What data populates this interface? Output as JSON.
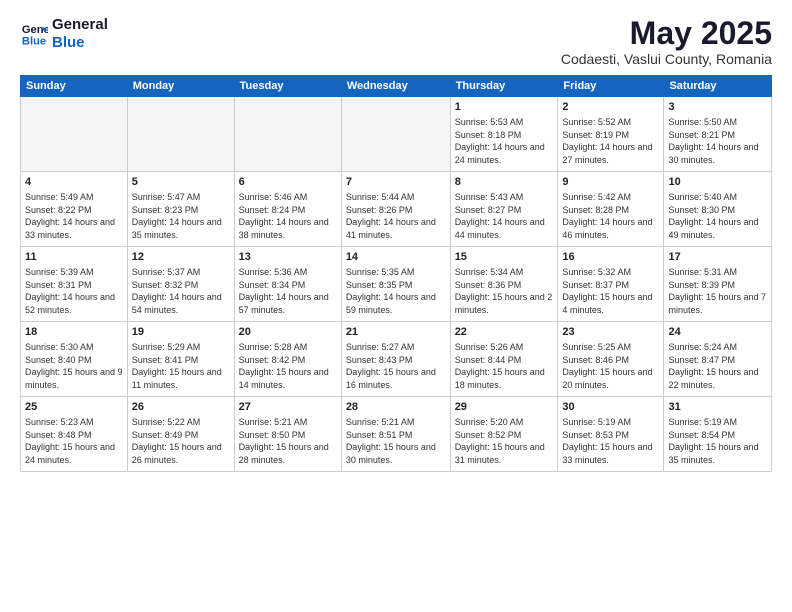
{
  "header": {
    "logo_line1": "General",
    "logo_line2": "Blue",
    "title": "May 2025",
    "subtitle": "Codaesti, Vaslui County, Romania"
  },
  "days": [
    "Sunday",
    "Monday",
    "Tuesday",
    "Wednesday",
    "Thursday",
    "Friday",
    "Saturday"
  ],
  "weeks": [
    [
      {
        "date": "",
        "info": ""
      },
      {
        "date": "",
        "info": ""
      },
      {
        "date": "",
        "info": ""
      },
      {
        "date": "",
        "info": ""
      },
      {
        "date": "1",
        "info": "Sunrise: 5:53 AM\nSunset: 8:18 PM\nDaylight: 14 hours and 24 minutes."
      },
      {
        "date": "2",
        "info": "Sunrise: 5:52 AM\nSunset: 8:19 PM\nDaylight: 14 hours and 27 minutes."
      },
      {
        "date": "3",
        "info": "Sunrise: 5:50 AM\nSunset: 8:21 PM\nDaylight: 14 hours and 30 minutes."
      }
    ],
    [
      {
        "date": "4",
        "info": "Sunrise: 5:49 AM\nSunset: 8:22 PM\nDaylight: 14 hours and 33 minutes."
      },
      {
        "date": "5",
        "info": "Sunrise: 5:47 AM\nSunset: 8:23 PM\nDaylight: 14 hours and 35 minutes."
      },
      {
        "date": "6",
        "info": "Sunrise: 5:46 AM\nSunset: 8:24 PM\nDaylight: 14 hours and 38 minutes."
      },
      {
        "date": "7",
        "info": "Sunrise: 5:44 AM\nSunset: 8:26 PM\nDaylight: 14 hours and 41 minutes."
      },
      {
        "date": "8",
        "info": "Sunrise: 5:43 AM\nSunset: 8:27 PM\nDaylight: 14 hours and 44 minutes."
      },
      {
        "date": "9",
        "info": "Sunrise: 5:42 AM\nSunset: 8:28 PM\nDaylight: 14 hours and 46 minutes."
      },
      {
        "date": "10",
        "info": "Sunrise: 5:40 AM\nSunset: 8:30 PM\nDaylight: 14 hours and 49 minutes."
      }
    ],
    [
      {
        "date": "11",
        "info": "Sunrise: 5:39 AM\nSunset: 8:31 PM\nDaylight: 14 hours and 52 minutes."
      },
      {
        "date": "12",
        "info": "Sunrise: 5:37 AM\nSunset: 8:32 PM\nDaylight: 14 hours and 54 minutes."
      },
      {
        "date": "13",
        "info": "Sunrise: 5:36 AM\nSunset: 8:34 PM\nDaylight: 14 hours and 57 minutes."
      },
      {
        "date": "14",
        "info": "Sunrise: 5:35 AM\nSunset: 8:35 PM\nDaylight: 14 hours and 59 minutes."
      },
      {
        "date": "15",
        "info": "Sunrise: 5:34 AM\nSunset: 8:36 PM\nDaylight: 15 hours and 2 minutes."
      },
      {
        "date": "16",
        "info": "Sunrise: 5:32 AM\nSunset: 8:37 PM\nDaylight: 15 hours and 4 minutes."
      },
      {
        "date": "17",
        "info": "Sunrise: 5:31 AM\nSunset: 8:39 PM\nDaylight: 15 hours and 7 minutes."
      }
    ],
    [
      {
        "date": "18",
        "info": "Sunrise: 5:30 AM\nSunset: 8:40 PM\nDaylight: 15 hours and 9 minutes."
      },
      {
        "date": "19",
        "info": "Sunrise: 5:29 AM\nSunset: 8:41 PM\nDaylight: 15 hours and 11 minutes."
      },
      {
        "date": "20",
        "info": "Sunrise: 5:28 AM\nSunset: 8:42 PM\nDaylight: 15 hours and 14 minutes."
      },
      {
        "date": "21",
        "info": "Sunrise: 5:27 AM\nSunset: 8:43 PM\nDaylight: 15 hours and 16 minutes."
      },
      {
        "date": "22",
        "info": "Sunrise: 5:26 AM\nSunset: 8:44 PM\nDaylight: 15 hours and 18 minutes."
      },
      {
        "date": "23",
        "info": "Sunrise: 5:25 AM\nSunset: 8:46 PM\nDaylight: 15 hours and 20 minutes."
      },
      {
        "date": "24",
        "info": "Sunrise: 5:24 AM\nSunset: 8:47 PM\nDaylight: 15 hours and 22 minutes."
      }
    ],
    [
      {
        "date": "25",
        "info": "Sunrise: 5:23 AM\nSunset: 8:48 PM\nDaylight: 15 hours and 24 minutes."
      },
      {
        "date": "26",
        "info": "Sunrise: 5:22 AM\nSunset: 8:49 PM\nDaylight: 15 hours and 26 minutes."
      },
      {
        "date": "27",
        "info": "Sunrise: 5:21 AM\nSunset: 8:50 PM\nDaylight: 15 hours and 28 minutes."
      },
      {
        "date": "28",
        "info": "Sunrise: 5:21 AM\nSunset: 8:51 PM\nDaylight: 15 hours and 30 minutes."
      },
      {
        "date": "29",
        "info": "Sunrise: 5:20 AM\nSunset: 8:52 PM\nDaylight: 15 hours and 31 minutes."
      },
      {
        "date": "30",
        "info": "Sunrise: 5:19 AM\nSunset: 8:53 PM\nDaylight: 15 hours and 33 minutes."
      },
      {
        "date": "31",
        "info": "Sunrise: 5:19 AM\nSunset: 8:54 PM\nDaylight: 15 hours and 35 minutes."
      }
    ]
  ]
}
